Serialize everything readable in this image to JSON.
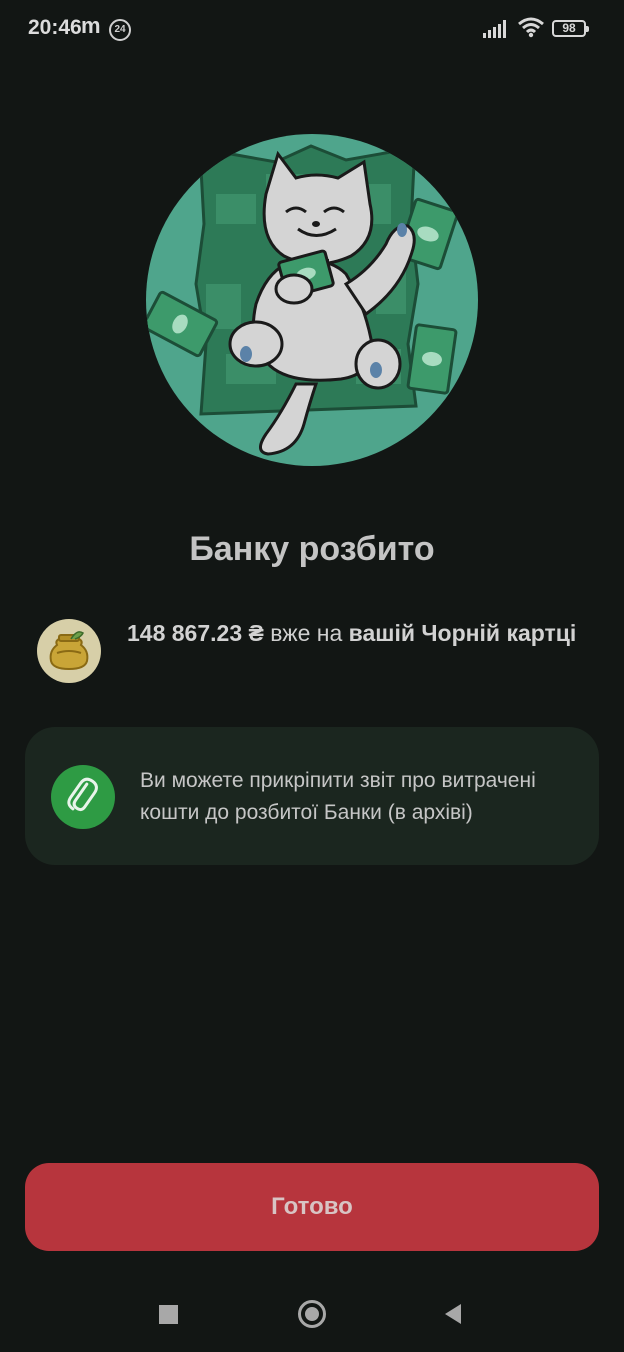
{
  "status_bar": {
    "time": "20:46",
    "app_indicator": "m",
    "notification_badge": "24",
    "battery_level": "98",
    "icons": [
      "signal-icon",
      "wifi-icon",
      "battery-icon"
    ]
  },
  "hero": {
    "image": "cat-with-money-illustration"
  },
  "title": "Банку розбито",
  "amount": {
    "value": "148 867.23 ₴",
    "middle": " вже на ",
    "card_name": "вашій Чорній картці",
    "icon": "jar-icon"
  },
  "info_card": {
    "icon": "paperclip-icon",
    "text": "Ви можете прикріпити звіт про витрачені кошти до розбитої Банки (в архіві)"
  },
  "done_button": {
    "label": "Готово"
  },
  "nav_bar": {
    "icons": [
      "recents-square-icon",
      "home-circle-icon",
      "back-triangle-icon"
    ]
  },
  "colors": {
    "background": "#121614",
    "card_background": "#1b261f",
    "accent_green": "#2e9b44",
    "button_red": "#b7353d",
    "hero_teal": "#4fa58c"
  }
}
